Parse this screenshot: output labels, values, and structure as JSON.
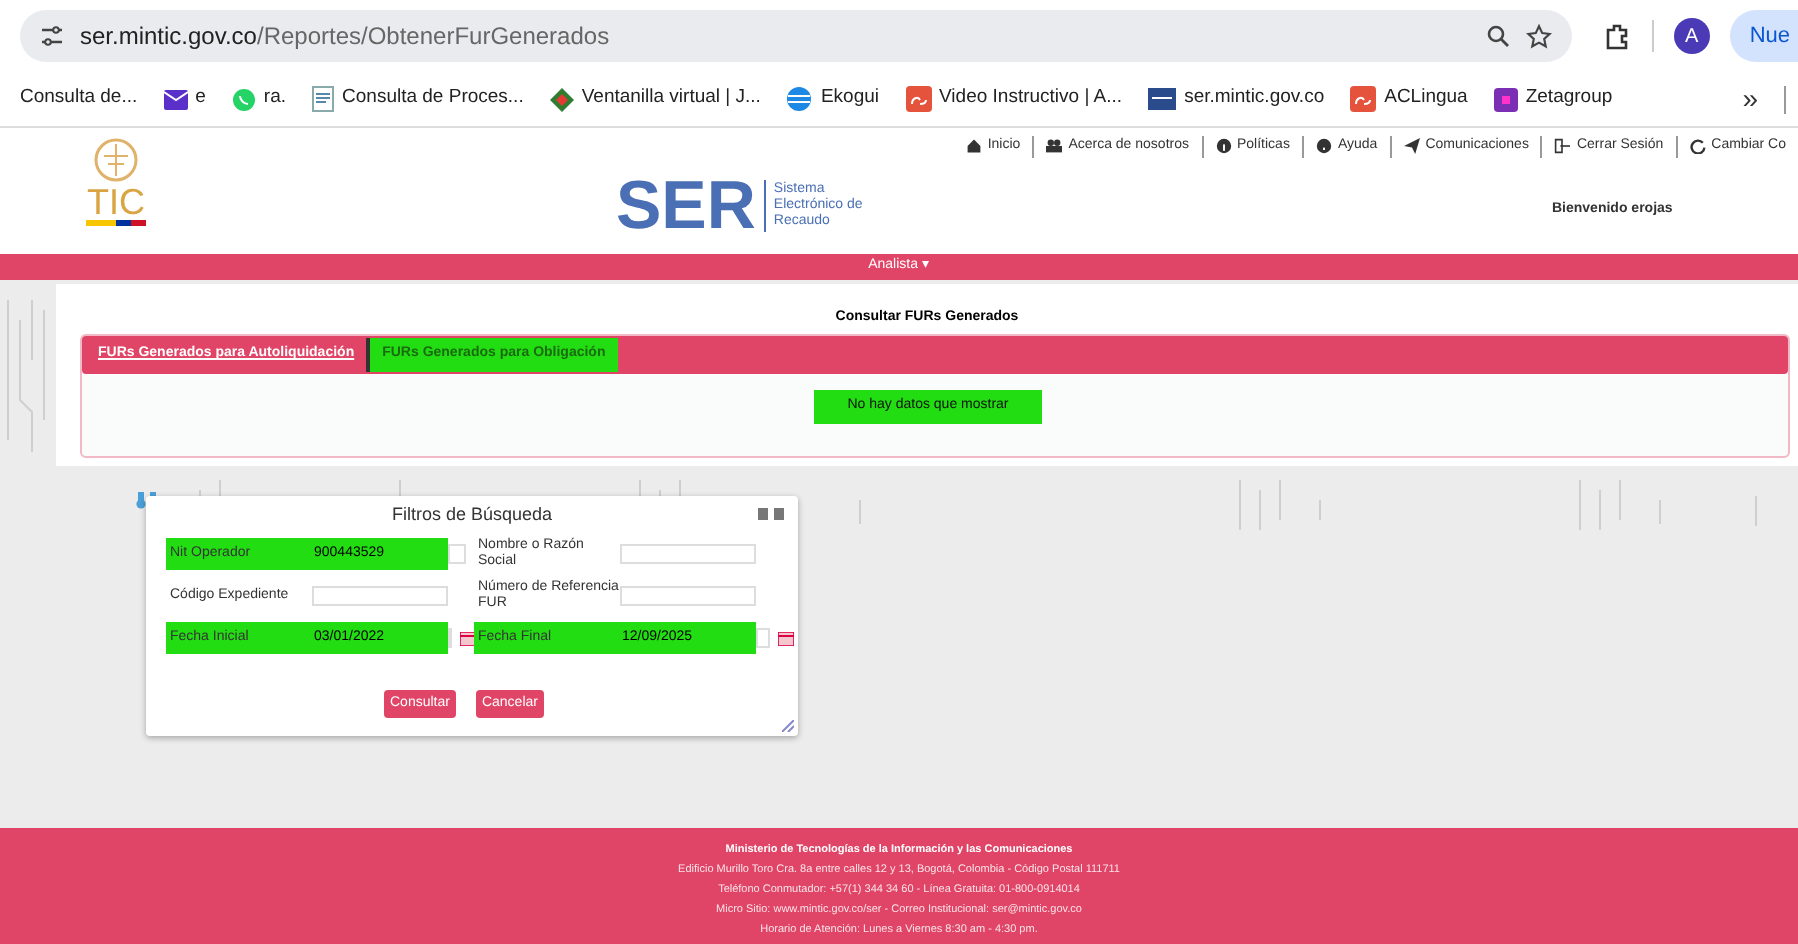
{
  "browser": {
    "url_host": "ser.mintic.gov.co",
    "url_path": "/Reportes/ObtenerFurGenerados",
    "profile_initial": "A",
    "profile_button": "Nue"
  },
  "bookmarks": [
    {
      "label": "Consulta de...",
      "kind": "none"
    },
    {
      "label": "e",
      "kind": "mail"
    },
    {
      "label": "ra.",
      "kind": "chat"
    },
    {
      "label": "Consulta de Proces...",
      "kind": "doc"
    },
    {
      "label": "Ventanilla virtual | J...",
      "kind": "diamond"
    },
    {
      "label": "Ekogui",
      "kind": "globe"
    },
    {
      "label": "Video Instructivo | A...",
      "kind": "ac"
    },
    {
      "label": "ser.mintic.gov.co",
      "kind": "ser"
    },
    {
      "label": "ACLingua",
      "kind": "ac"
    },
    {
      "label": "Zetagroup",
      "kind": "square"
    }
  ],
  "bookmarks_more": "»",
  "header": {
    "logo_text": "TIC",
    "brand": "SER",
    "brand_subtitle": [
      "Sistema",
      "Electrónico de",
      "Recaudo"
    ],
    "top_links": [
      {
        "label": "Inicio",
        "kind": "home"
      },
      {
        "label": "Acerca de nosotros",
        "kind": "people"
      },
      {
        "label": "Políticas",
        "kind": "info"
      },
      {
        "label": "Ayuda",
        "kind": "help"
      },
      {
        "label": "Comunicaciones",
        "kind": "send"
      },
      {
        "label": "Cerrar Sesión",
        "kind": "exit"
      },
      {
        "label": "Cambiar Co",
        "kind": "refresh"
      }
    ],
    "welcome": "Bienvenido erojas"
  },
  "nav": {
    "label": "Analista",
    "caret": "▾"
  },
  "content": {
    "title": "Consultar FURs Generados",
    "tabs": [
      {
        "label": "FURs Generados para Autoliquidación",
        "selected": true,
        "highlighted": false
      },
      {
        "label": "FURs Generados para Obligación",
        "selected": false,
        "highlighted": true
      }
    ],
    "empty_message": "No hay datos que mostrar"
  },
  "filter_dialog": {
    "title": "Filtros de Búsqueda",
    "fields": [
      {
        "label": "Nit Operador",
        "value": "900443529",
        "highlighted": true,
        "calendar": false
      },
      {
        "label": "Nombre o Razón Social",
        "highlighted": false,
        "calendar": false
      },
      {
        "label": "Código Expediente",
        "highlighted": false,
        "calendar": false
      },
      {
        "label": "Número de Referencia FUR",
        "highlighted": false,
        "calendar": false
      },
      {
        "label": "Fecha Inicial",
        "value": "03/01/2022",
        "highlighted": true,
        "calendar": true
      },
      {
        "label": "Fecha Final",
        "value": "12/09/2025",
        "highlighted": true,
        "calendar": true
      }
    ],
    "buttons": [
      "Consultar",
      "Cancelar"
    ]
  },
  "footer": {
    "lines": [
      "Ministerio de Tecnologías de la Información y las Comunicaciones",
      "Edificio Murillo Toro Cra. 8a entre calles 12 y 13, Bogotá, Colombia - Código Postal 111711",
      "Teléfono Conmutador: +57(1) 344 34 60 - Línea Gratuita: 01-800-0914014",
      "Micro Sitio: www.mintic.gov.co/ser - Correo Institucional: ser@mintic.gov.co",
      "Horario de Atención: Lunes a Viernes 8:30 am - 4:30 pm."
    ]
  }
}
